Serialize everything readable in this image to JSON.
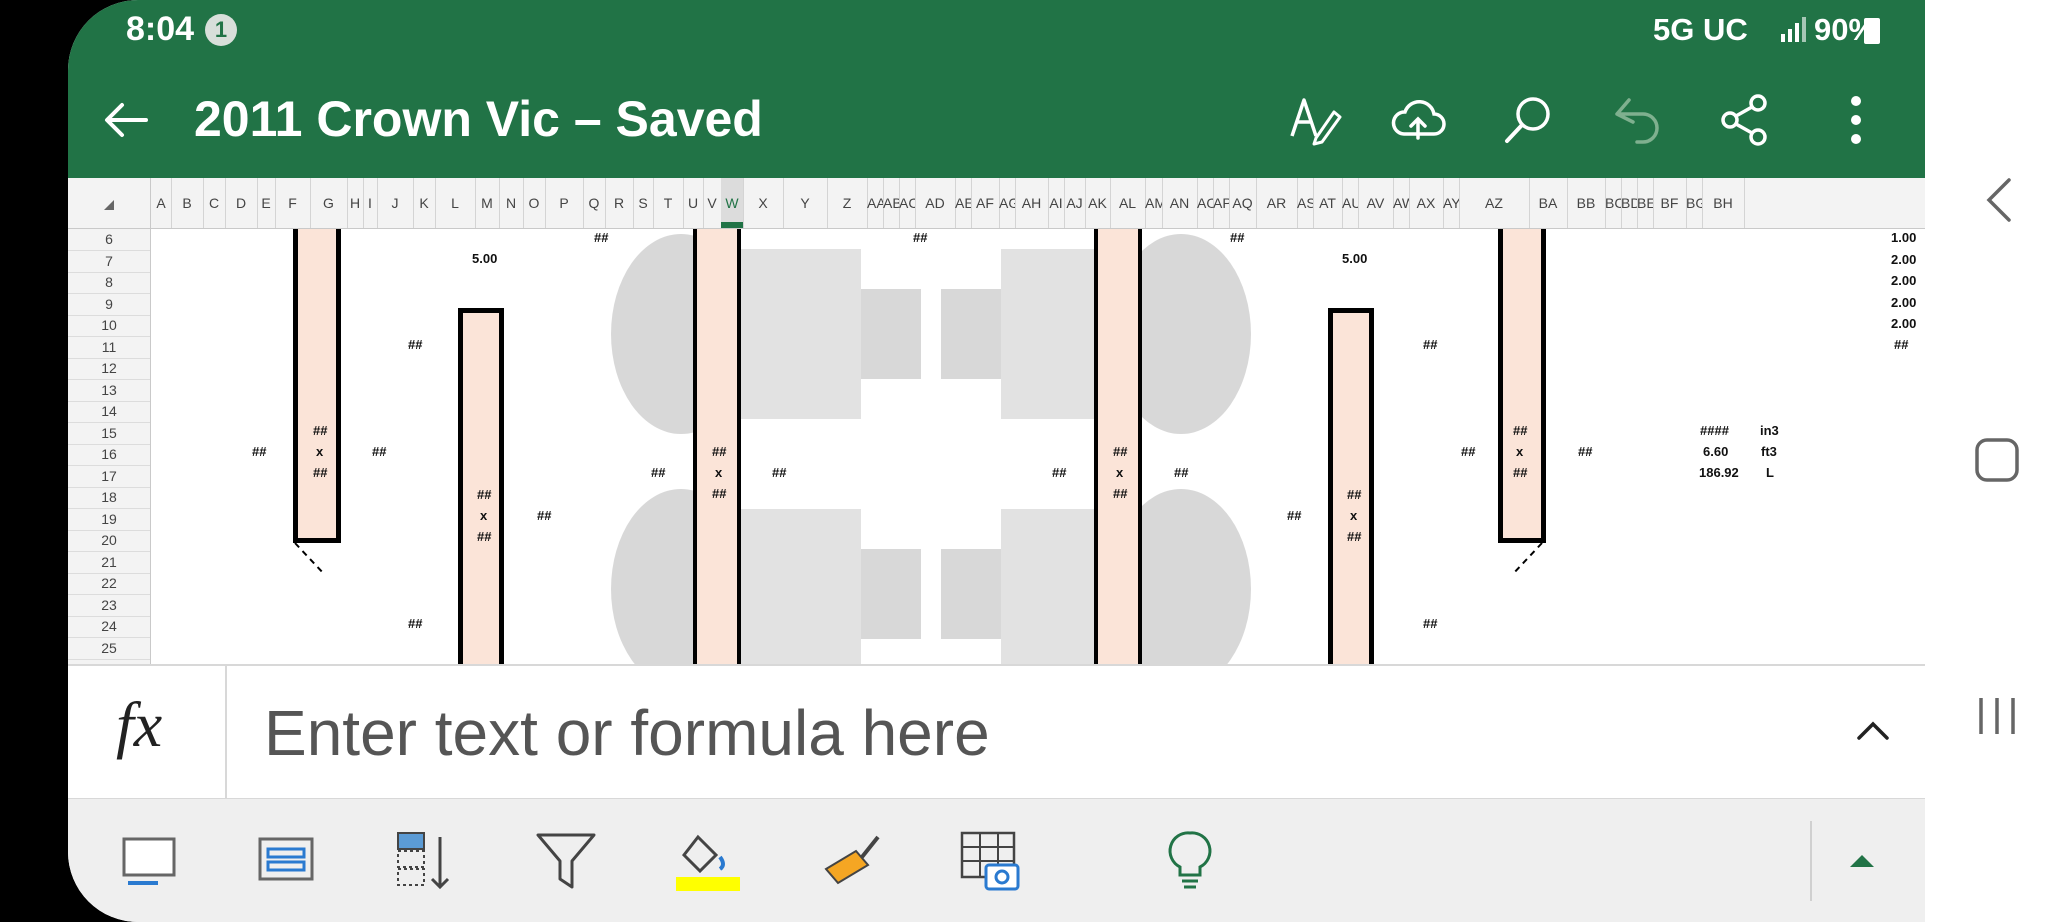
{
  "status_bar": {
    "time": "8:04",
    "notification_count": "1",
    "network": "5G UC",
    "battery": "90%"
  },
  "app_bar": {
    "title": "2011 Crown Vic – Saved",
    "accent": "#217346",
    "actions": [
      "format-text-icon",
      "cloud-upload-icon",
      "search-icon",
      "undo-icon",
      "share-icon",
      "more-options-icon"
    ]
  },
  "column_headers": [
    "A",
    "B",
    "C",
    "D",
    "E",
    "F",
    "G",
    "H",
    "I",
    "J",
    "K",
    "L",
    "M",
    "N",
    "O",
    "P",
    "Q",
    "R",
    "S",
    "T",
    "U",
    "V",
    "W",
    "X",
    "Y",
    "Z",
    "AA",
    "AB",
    "AC",
    "AD",
    "AE",
    "AF",
    "AG",
    "AH",
    "AI",
    "AJ",
    "AK",
    "AL",
    "AM",
    "AN",
    "AO",
    "AP",
    "AQ",
    "AR",
    "AS",
    "AT",
    "AU",
    "AV",
    "AW",
    "AX",
    "AY",
    "AZ",
    "BA",
    "BB",
    "BC",
    "BD",
    "BE",
    "BF",
    "BG",
    "BH"
  ],
  "selected_column": "W",
  "row_headers": [
    "6",
    "7",
    "8",
    "9",
    "10",
    "11",
    "12",
    "13",
    "14",
    "15",
    "16",
    "17",
    "18",
    "19",
    "20",
    "21",
    "22",
    "23",
    "24",
    "25"
  ],
  "cells": {
    "hash": "##",
    "hash_long": "####",
    "x": "x",
    "val_5": "5.00",
    "ratio_values": [
      "1.00",
      "2.00",
      "2.00",
      "2.00",
      "2.00"
    ],
    "eq": "=",
    "volume": {
      "v1": "####",
      "u1": "in3",
      "v2": "6.60",
      "u2": "ft3",
      "v3": "186.92",
      "u3": "L"
    }
  },
  "formula_bar": {
    "placeholder": "Enter text or formula here"
  },
  "bottom_toolbar": [
    "select-cells-icon",
    "view-icon",
    "sort-icon",
    "filter-icon",
    "fill-color-icon",
    "format-painter-icon",
    "insert-table-picture-icon",
    "ideas-icon",
    "expand-toolbar-icon"
  ],
  "fill_color": "#ffff00",
  "nav_bar": [
    "back-nav-icon",
    "home-nav-icon",
    "recents-nav-icon"
  ]
}
